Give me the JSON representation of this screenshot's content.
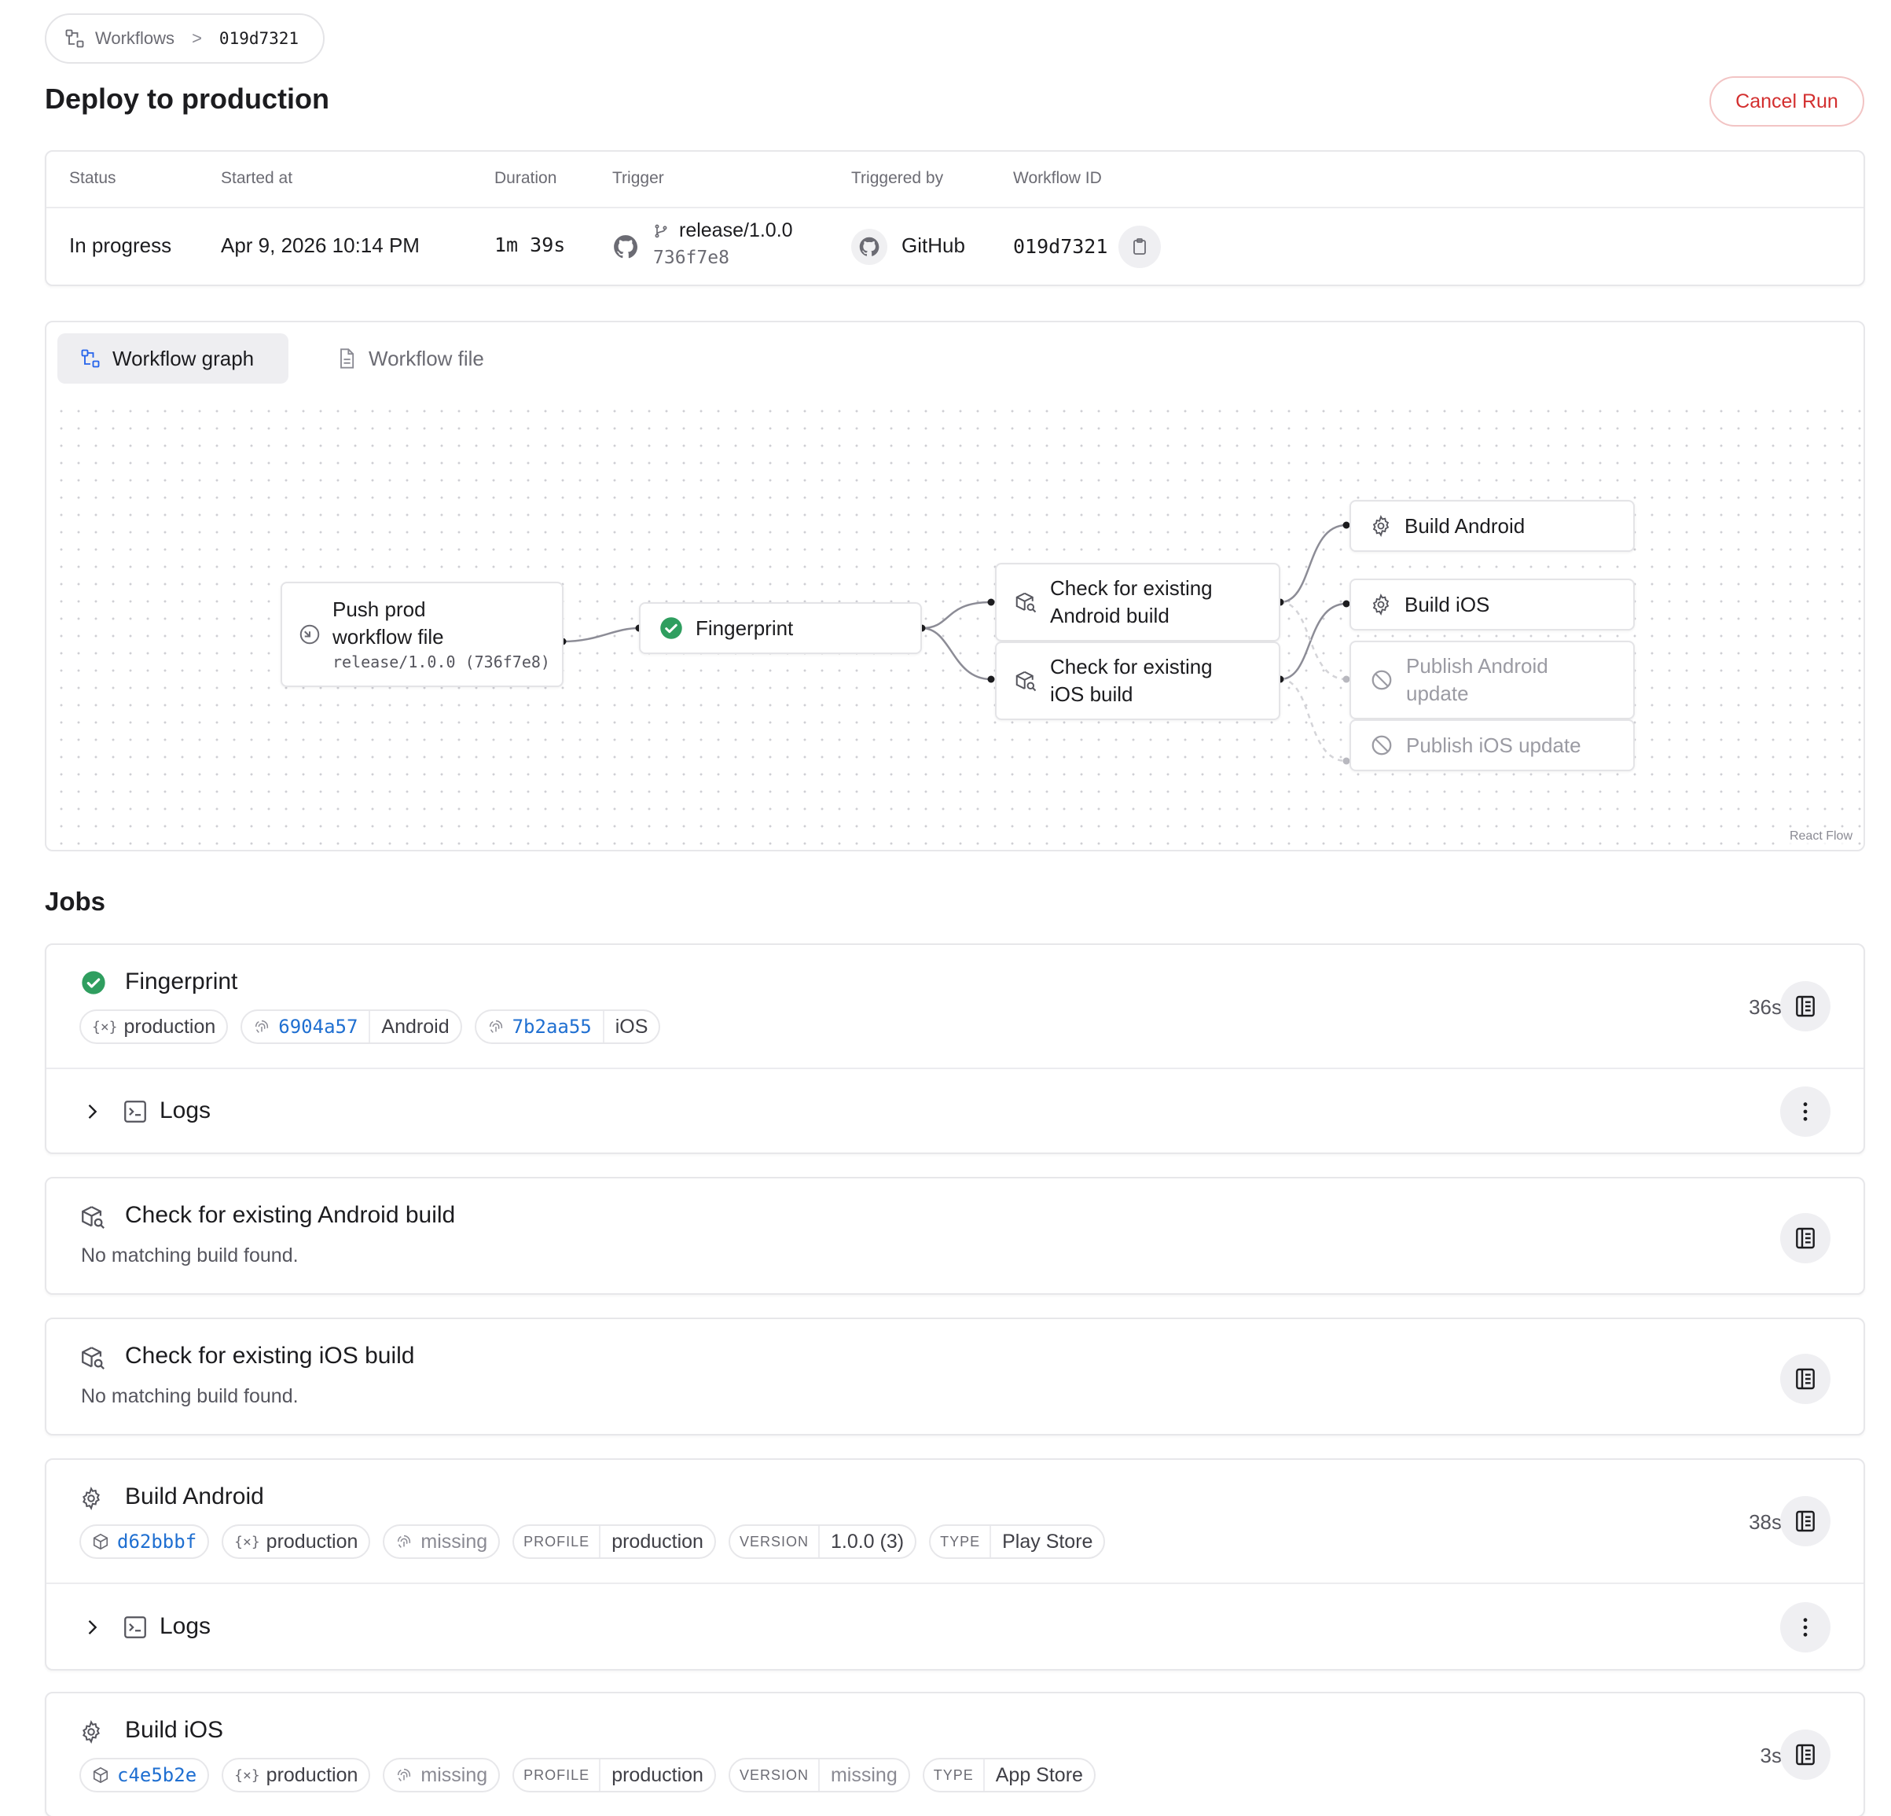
{
  "breadcrumb": {
    "workflows_label": "Workflows",
    "separator": ">",
    "current": "019d7321"
  },
  "page": {
    "title": "Deploy to production",
    "cancel_label": "Cancel Run"
  },
  "info": {
    "headers": {
      "status": "Status",
      "started": "Started at",
      "duration": "Duration",
      "trigger": "Trigger",
      "triggered_by": "Triggered by",
      "workflow_id": "Workflow ID"
    },
    "status": "In progress",
    "started": "Apr 9, 2026 10:14 PM",
    "duration": "1m 39s",
    "trigger_branch": "release/1.0.0",
    "trigger_commit": "736f7e8",
    "triggered_by": "GitHub",
    "workflow_id": "019d7321"
  },
  "tabs": {
    "graph": "Workflow graph",
    "file": "Workflow file"
  },
  "graph": {
    "attribution": "React Flow",
    "nodes": {
      "push": {
        "line1": "Push prod",
        "line2": "workflow file",
        "sub": "release/1.0.0 (736f7e8)"
      },
      "fingerprint": {
        "label": "Fingerprint"
      },
      "check_android": {
        "line1": "Check for existing",
        "line2": "Android build"
      },
      "check_ios": {
        "line1": "Check for existing",
        "line2": "iOS build"
      },
      "build_android": {
        "label": "Build Android"
      },
      "build_ios": {
        "label": "Build iOS"
      },
      "publish_android": {
        "line1": "Publish Android",
        "line2": "update"
      },
      "publish_ios": {
        "label": "Publish iOS update"
      }
    },
    "colors": {
      "success": "#2f9e5f",
      "edge": "#8c8c96",
      "edge_faded": "#d4d4d8"
    }
  },
  "jobs": {
    "title": "Jobs",
    "fingerprint": {
      "title": "Fingerprint",
      "duration": "36s",
      "env": "production",
      "android_hash": "6904a57",
      "android_label": "Android",
      "ios_hash": "7b2aa55",
      "ios_label": "iOS",
      "logs_label": "Logs"
    },
    "check_android": {
      "title": "Check for existing Android build",
      "subtitle": "No matching build found."
    },
    "check_ios": {
      "title": "Check for existing iOS build",
      "subtitle": "No matching build found."
    },
    "build_android": {
      "title": "Build Android",
      "duration": "38s",
      "build_id": "d62bbbf",
      "env": "production",
      "fingerprint": "missing",
      "profile_key": "PROFILE",
      "profile": "production",
      "version_key": "VERSION",
      "version": "1.0.0 (3)",
      "type_key": "TYPE",
      "type": "Play Store",
      "logs_label": "Logs"
    },
    "build_ios": {
      "title": "Build iOS",
      "duration": "3s",
      "build_id": "c4e5b2e",
      "env": "production",
      "fingerprint": "missing",
      "profile_key": "PROFILE",
      "profile": "production",
      "version_key": "VERSION",
      "version": "missing",
      "type_key": "TYPE",
      "type": "App Store"
    }
  }
}
